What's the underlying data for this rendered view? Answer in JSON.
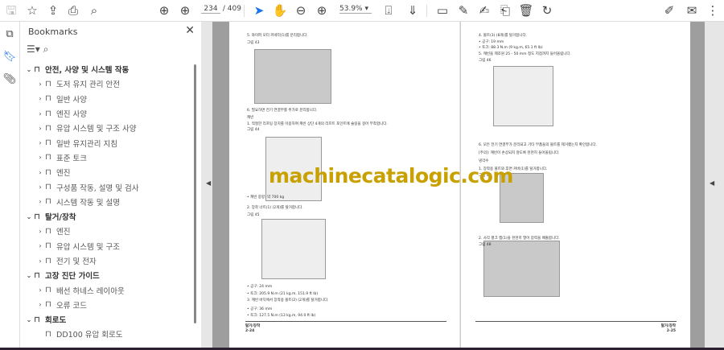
{
  "toolbar": {
    "page_current": "234",
    "page_total": "/ 409",
    "zoom": "53.9%"
  },
  "bookmarks": {
    "title": "Bookmarks",
    "items": [
      {
        "label": "안전, 사양 및 시스템 작동",
        "level": 0
      },
      {
        "label": "도저 유지 관리 안전",
        "level": 1
      },
      {
        "label": "일반 사양",
        "level": 1
      },
      {
        "label": "엔진 사양",
        "level": 1
      },
      {
        "label": "유압 시스템 및 구조 사양",
        "level": 1
      },
      {
        "label": "일반 유지관리 지침",
        "level": 1
      },
      {
        "label": "표준 토크",
        "level": 1
      },
      {
        "label": "엔진",
        "level": 1
      },
      {
        "label": "구성품 작동, 설명 및 검사",
        "level": 1
      },
      {
        "label": "시스템 작동 및 설명",
        "level": 1
      },
      {
        "label": "탈거/장착",
        "level": 0
      },
      {
        "label": "엔진",
        "level": 1
      },
      {
        "label": "유압 시스템 및 구조",
        "level": 1
      },
      {
        "label": "전기 및 전자",
        "level": 1
      },
      {
        "label": "고장 진단 가이드",
        "level": 0
      },
      {
        "label": "배선 하네스 레이아웃",
        "level": 1
      },
      {
        "label": "오류 코드",
        "level": 1
      },
      {
        "label": "회로도",
        "level": 0
      },
      {
        "label": "DD100 유압 회로도",
        "level": 2
      }
    ]
  },
  "left_page": {
    "lines": [
      "5. 와이퍼 모터 커넥터(1)를 분리합니다.",
      "그림 43",
      "6. 필요하면 전기 연결부를 추가로 분리합니다.",
      "캐빈",
      "1. 적절한 리프팅 장치를 이용하여 캐빈 상단 4개의 리프트 포인트에 슬링을 걸어 부착합니다.",
      "그림 44",
      "• 캐빈 중량: 약 700 kg",
      "2. 장착 너트(1) (2개)를 탈거합니다.",
      "그림 45",
      "• 공구: 24 mm",
      "• 토크: 205.9 N.m (21 kg.m, 151.9 ft lb)",
      "3. 캐빈 바닥에서 장착용 볼트(2) (2개)를 탈거합니다.",
      "• 공구: 36 mm",
      "• 토크: 127.5 N.m (13 kg.m, 94.0 ft lb)"
    ],
    "footer_title": "탈거/장착",
    "footer_page": "2-24"
  },
  "right_page": {
    "lines": [
      "4. 볼트(3) (8개)를 탈거합니다.",
      "• 공구: 19 mm",
      "• 토크: 88.3 N.m (9 kg.m, 65.1 ft lb)",
      "5. 캐빈을 제조원 25 - 50 mm 정도 지점까지 들어올립니다.",
      "그림 46",
      "6. 모든 전기 연결부가 분리되고 기타 부품들의 볼트를 제거했는지 확인합니다.",
      "[주의]: 캐빈이 손상되지 않도록 천천히 들어올립니다.",
      "냉각수",
      "1. 장착용 볼트와 후면 커버(1)를 탈거합니다.",
      "그림 47",
      "2. 사각 평크 캡(1)을 천천히 열어 압력을 배출합니다.",
      "그림 48"
    ],
    "footer_title": "탈거/장착",
    "footer_page": "2-25"
  },
  "watermark": "machinecatalogic.com"
}
